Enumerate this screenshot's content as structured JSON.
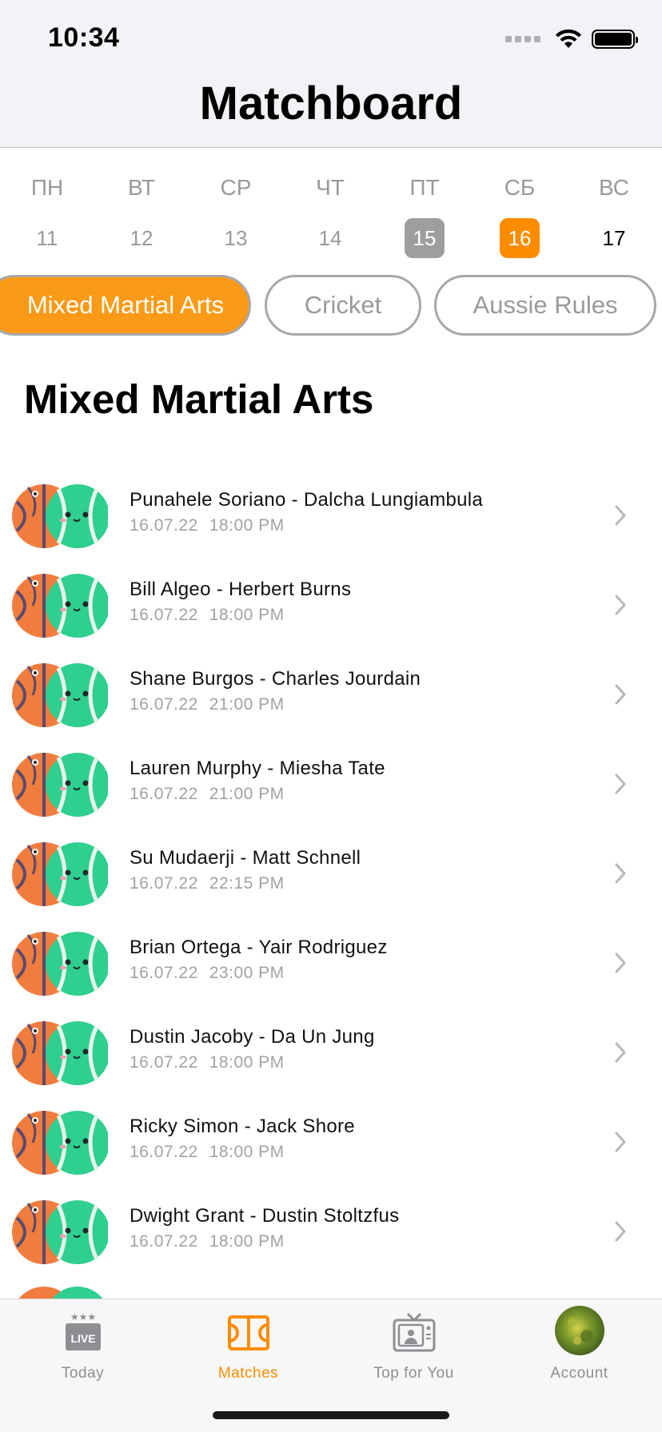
{
  "status_bar": {
    "time": "10:34"
  },
  "header": {
    "title": "Matchboard"
  },
  "week": [
    {
      "name": "ПН",
      "date": "11",
      "state": "plain"
    },
    {
      "name": "ВТ",
      "date": "12",
      "state": "plain"
    },
    {
      "name": "СР",
      "date": "13",
      "state": "plain"
    },
    {
      "name": "ЧТ",
      "date": "14",
      "state": "plain"
    },
    {
      "name": "ПТ",
      "date": "15",
      "state": "past"
    },
    {
      "name": "СБ",
      "date": "16",
      "state": "active"
    },
    {
      "name": "ВС",
      "date": "17",
      "state": "future"
    }
  ],
  "chips": [
    {
      "label": "Mixed Martial Arts",
      "selected": true
    },
    {
      "label": "Cricket",
      "selected": false
    },
    {
      "label": "Aussie Rules",
      "selected": false
    }
  ],
  "section": {
    "title": "Mixed Martial Arts"
  },
  "matches": [
    {
      "title": "Punahele Soriano - Dalcha Lungiambula",
      "date": "16.07.22",
      "time": "18:00 PM"
    },
    {
      "title": "Bill Algeo - Herbert Burns",
      "date": "16.07.22",
      "time": "18:00 PM"
    },
    {
      "title": "Shane Burgos - Charles Jourdain",
      "date": "16.07.22",
      "time": "21:00 PM"
    },
    {
      "title": "Lauren Murphy - Miesha Tate",
      "date": "16.07.22",
      "time": "21:00 PM"
    },
    {
      "title": "Su Mudaerji - Matt Schnell",
      "date": "16.07.22",
      "time": "22:15 PM"
    },
    {
      "title": "Brian Ortega - Yair Rodriguez",
      "date": "16.07.22",
      "time": "23:00 PM"
    },
    {
      "title": "Dustin Jacoby - Da Un Jung",
      "date": "16.07.22",
      "time": "18:00 PM"
    },
    {
      "title": "Ricky Simon - Jack Shore",
      "date": "16.07.22",
      "time": "18:00 PM"
    },
    {
      "title": "Dwight Grant - Dustin Stoltzfus",
      "date": "16.07.22",
      "time": "18:00 PM"
    }
  ],
  "tabbar": {
    "tabs": [
      {
        "label": "Today",
        "icon": "live-icon",
        "active": false
      },
      {
        "label": "Matches",
        "icon": "court-icon",
        "active": true
      },
      {
        "label": "Top for You",
        "icon": "tv-icon",
        "active": false
      },
      {
        "label": "Account",
        "icon": "avatar-photo",
        "active": false
      }
    ]
  },
  "colors": {
    "accent": "#fb8c00",
    "chip_selected": "#fb9a16",
    "past_day": "#9e9e9e",
    "muted_text": "#9a9a9e",
    "header_bg": "#f2f2f7"
  }
}
